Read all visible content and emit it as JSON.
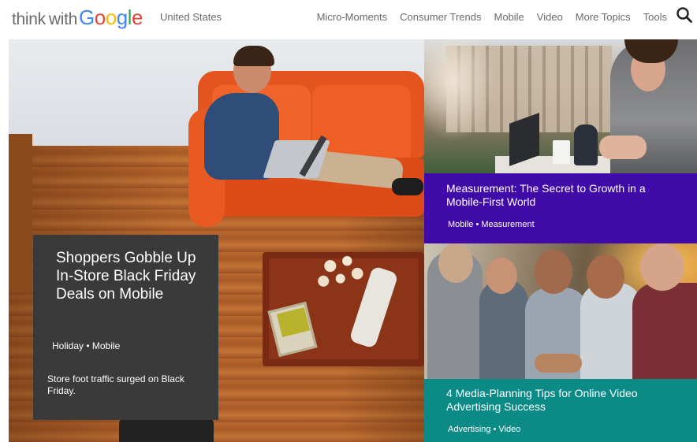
{
  "header": {
    "logo": {
      "think": "think",
      "with": "with",
      "google_letters": [
        "G",
        "o",
        "o",
        "g",
        "l",
        "e"
      ]
    },
    "region": "United States",
    "nav": [
      {
        "label": "Micro-Moments"
      },
      {
        "label": "Consumer Trends"
      },
      {
        "label": "Mobile"
      },
      {
        "label": "Video"
      },
      {
        "label": "More Topics"
      },
      {
        "label": "Tools"
      }
    ],
    "search_icon": "search-icon"
  },
  "featured": {
    "title": "Shoppers Gobble Up In-Store Black Friday Deals on Mobile",
    "tags": "Holiday • Mobile",
    "description": "Store foot traffic surged on Black Friday.",
    "card_color": "#3a3a3a"
  },
  "articles": [
    {
      "title": "Measurement: The Secret to Growth in a Mobile-First World",
      "tags": "Mobile • Measurement",
      "band_color": "#3f0aa8"
    },
    {
      "title": "4 Media-Planning Tips for Online Video Advertising Success",
      "tags": "Advertising • Video",
      "band_color": "#0b8a86"
    }
  ],
  "colors": {
    "google_blue": "#4285F4",
    "google_red": "#EA4335",
    "google_yellow": "#FBBC05",
    "google_green": "#34A853",
    "nav_text": "#6b6b6b"
  }
}
